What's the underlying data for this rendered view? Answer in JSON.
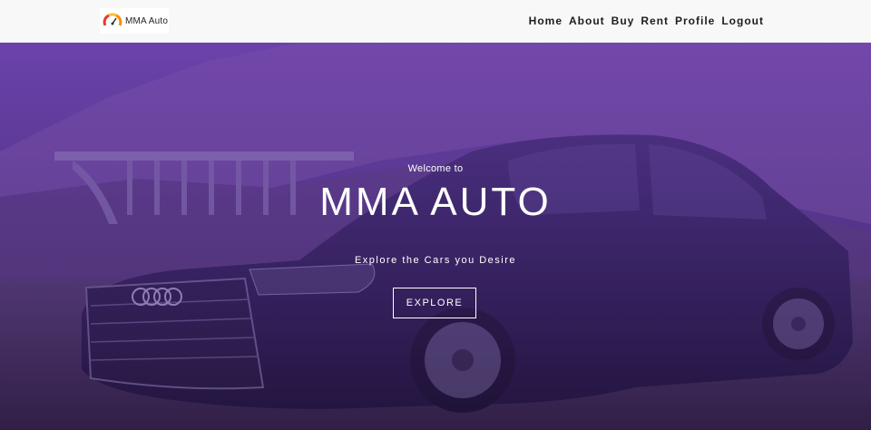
{
  "brand": {
    "name": "MMA Auto"
  },
  "nav": {
    "items": [
      {
        "label": "Home"
      },
      {
        "label": "About"
      },
      {
        "label": "Buy"
      },
      {
        "label": "Rent"
      },
      {
        "label": "Profile"
      },
      {
        "label": "Logout"
      }
    ]
  },
  "hero": {
    "welcome": "Welcome to",
    "title": "MMA AUTO",
    "tagline": "Explore the Cars you Desire",
    "button_label": "EXPLORE",
    "overlay_color": "#7a47c8"
  },
  "colors": {
    "navbar_bg": "#f8f8f8",
    "nav_text": "#1d1d1d",
    "hero_text": "#ffffff"
  }
}
